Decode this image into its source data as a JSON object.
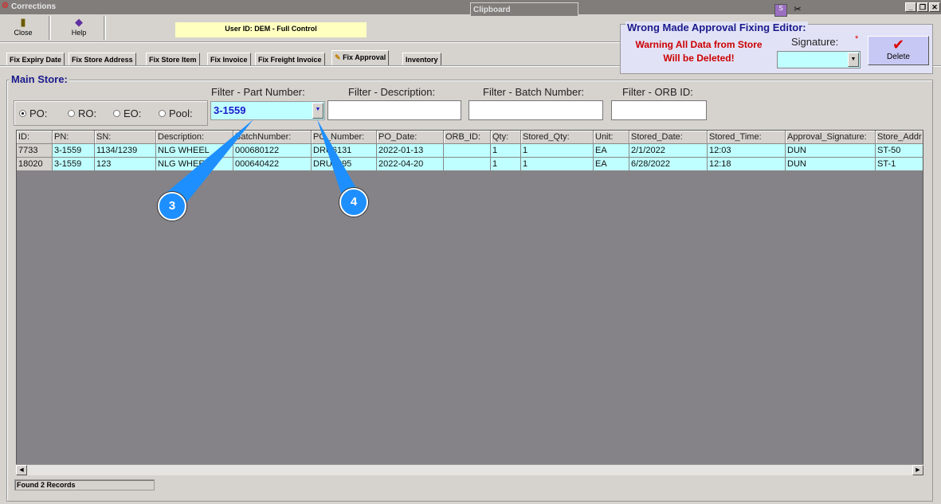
{
  "window": {
    "title": "Corrections",
    "clipboard": "Clipboard"
  },
  "toolbar": {
    "close_label": "Close",
    "help_label": "Help",
    "user_info": "User ID: DEM - Full Control"
  },
  "tabs": [
    "Fix Expiry Date",
    "Fix Store Address",
    "Fix Store Item",
    "Fix Invoice",
    "Fix Freight Invoice",
    "Fix Approval",
    "Inventory"
  ],
  "active_tab": "Fix Approval",
  "editor": {
    "title": "Wrong Made Approval Fixing Editor:",
    "warning_line1": "Warning All Data from Store",
    "warning_line2": "Will be Deleted!",
    "signature_label": "Signature:",
    "required_mark": "*",
    "signature_value": "",
    "delete_label": "Delete"
  },
  "main": {
    "group_label": "Main Store:",
    "radios": [
      {
        "label": "PO:",
        "checked": true
      },
      {
        "label": "RO:",
        "checked": false
      },
      {
        "label": "EO:",
        "checked": false
      },
      {
        "label": "Pool:",
        "checked": false
      }
    ],
    "filters": {
      "part_number_label": "Filter - Part Number:",
      "part_number_value": "3-1559",
      "description_label": "Filter - Description:",
      "description_value": "",
      "batch_label": "Filter - Batch Number:",
      "batch_value": "",
      "orb_label": "Filter - ORB ID:",
      "orb_value": ""
    }
  },
  "grid": {
    "columns": [
      "ID:",
      "PN:",
      "SN:",
      "Description:",
      "BatchNumber:",
      "PO_Number:",
      "PO_Date:",
      "ORB_ID:",
      "Qty:",
      "Stored_Qty:",
      "Unit:",
      "Stored_Date:",
      "Stored_Time:",
      "Approval_Signature:",
      "Store_Addr"
    ],
    "rows": [
      [
        "7733",
        "3-1559",
        "1134/1239",
        "NLG WHEEL",
        "000680122",
        "DRU6131",
        "2022-01-13",
        "",
        "1",
        "1",
        "EA",
        "2/1/2022",
        "12:03",
        "DUN",
        "ST-50"
      ],
      [
        "18020",
        "3-1559",
        "123",
        "NLG WHEEL",
        "000640422",
        "DRU4895",
        "2022-04-20",
        "",
        "1",
        "1",
        "EA",
        "6/28/2022",
        "12:18",
        "DUN",
        "ST-1"
      ]
    ]
  },
  "status": "Found 2 Records",
  "callouts": [
    "3",
    "4"
  ],
  "colors": {
    "accent": "#1a1a8c",
    "warning": "#cc0000",
    "grid_row": "#c0ffff",
    "callout": "#1e8fff"
  }
}
